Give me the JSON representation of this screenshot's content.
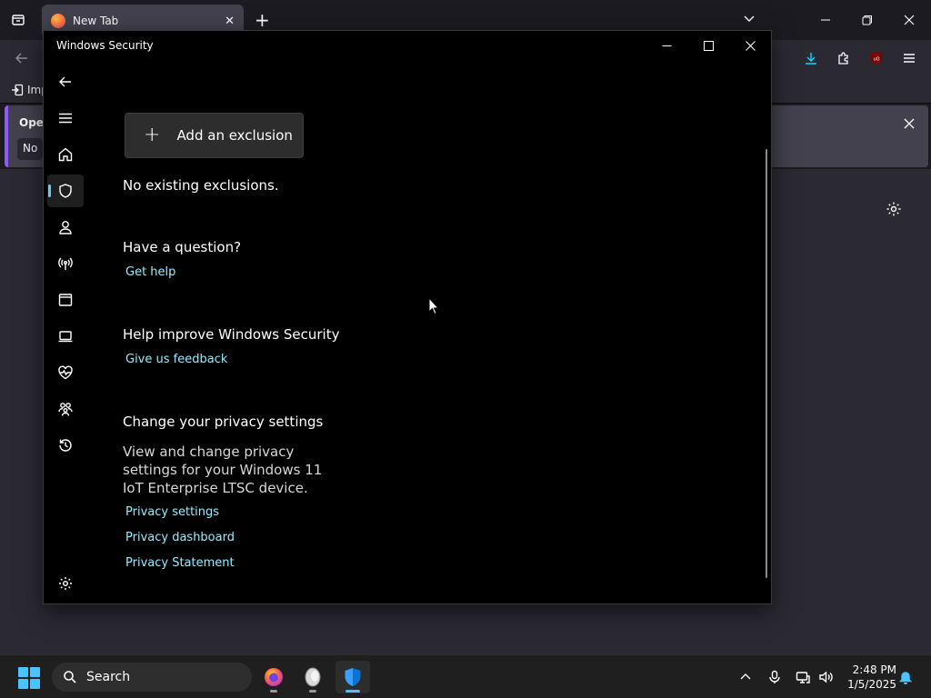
{
  "firefox": {
    "tab_title": "New Tab",
    "bookmark_partial": "Imp",
    "notif_title_partial": "Open",
    "notif_button_partial": "No"
  },
  "window": {
    "title": "Windows Security"
  },
  "nav": {
    "items": [
      "back-icon",
      "menu-icon",
      "home-icon",
      "shield-icon",
      "account-icon",
      "wifi-icon",
      "app-browser-icon",
      "device-icon",
      "health-icon",
      "family-icon",
      "history-icon",
      "settings-icon"
    ],
    "active": "shield-icon",
    "accent": "#60cdff"
  },
  "main": {
    "add_button_label": "Add an exclusion",
    "no_exclusions": "No existing exclusions.",
    "question_heading": "Have a question?",
    "get_help": "Get help",
    "improve_heading": "Help improve Windows Security",
    "feedback": "Give us feedback",
    "privacy_heading": "Change your privacy settings",
    "privacy_desc": "View and change privacy settings for your Windows 11 IoT Enterprise LTSC device.",
    "privacy_settings": "Privacy settings",
    "privacy_dashboard": "Privacy dashboard",
    "privacy_statement": "Privacy Statement",
    "link_color": "#99ebff"
  },
  "taskbar": {
    "search_label": "Search",
    "time": "2:48 PM",
    "date": "1/5/2025"
  }
}
